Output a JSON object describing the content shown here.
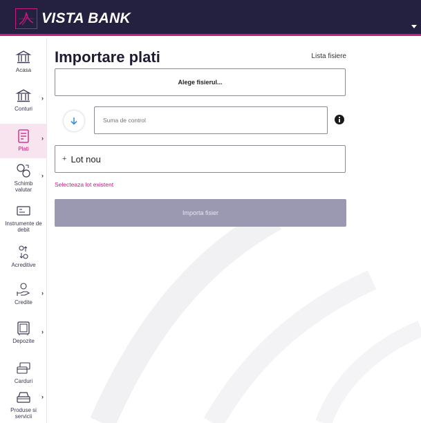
{
  "brand": {
    "name": "VISTA BANK"
  },
  "colors": {
    "header_bg": "#24203f",
    "accent": "#c9187f",
    "disabled_button": "#9b98b2"
  },
  "sidebar": {
    "items": [
      {
        "label": "Acasa",
        "icon": "bank-icon",
        "has_arrow": false,
        "active": false
      },
      {
        "label": "Conturi",
        "icon": "bank-icon",
        "has_arrow": true,
        "active": false
      },
      {
        "label": "Plati",
        "icon": "payments-icon",
        "has_arrow": true,
        "active": true
      },
      {
        "label": "Schimb valutar",
        "icon": "currency-exchange-icon",
        "has_arrow": true,
        "active": false
      },
      {
        "label": "Instrumente de debit",
        "icon": "debit-instrument-icon",
        "has_arrow": false,
        "active": false
      },
      {
        "label": "Acreditive",
        "icon": "letter-of-credit-icon",
        "has_arrow": false,
        "active": false
      },
      {
        "label": "Credite",
        "icon": "credit-hand-icon",
        "has_arrow": true,
        "active": false
      },
      {
        "label": "Depozite",
        "icon": "safe-icon",
        "has_arrow": true,
        "active": false
      },
      {
        "label": "Carduri",
        "icon": "cards-icon",
        "has_arrow": false,
        "active": false
      },
      {
        "label": "Produse si servicii",
        "icon": "products-icon",
        "has_arrow": true,
        "active": false
      }
    ]
  },
  "main": {
    "title": "Importare plati",
    "file_list_link": "Lista fisiere",
    "choose_file_button": "Alege fisierul...",
    "checksum_placeholder": "Suma de control",
    "new_lot_label": "Lot nou",
    "select_existing_link": "Selecteaza lot existent",
    "import_button": "Importa fisier"
  }
}
